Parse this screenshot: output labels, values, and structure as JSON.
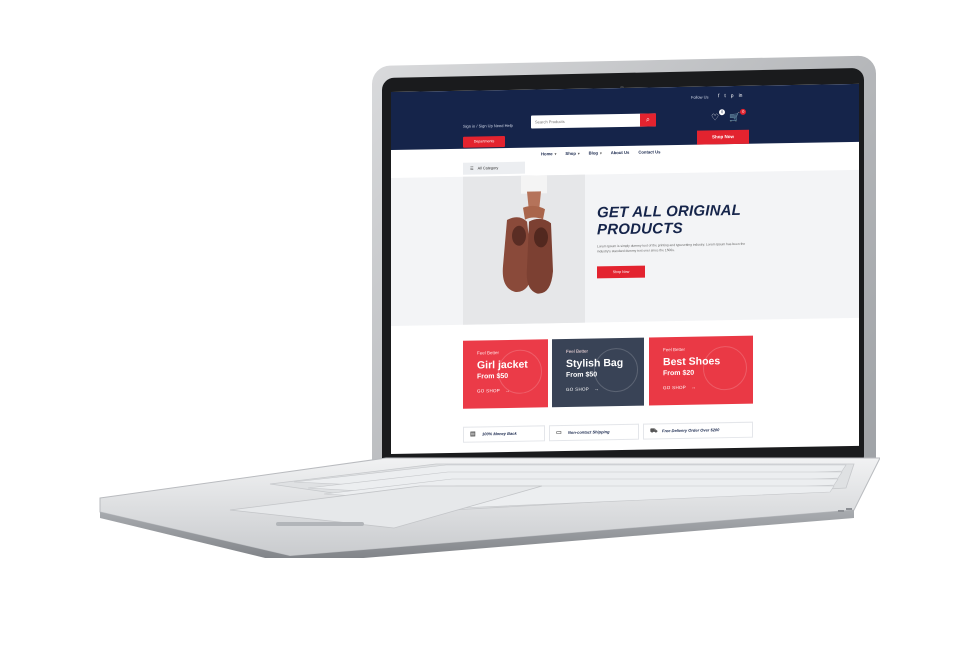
{
  "topbar": {
    "follow_label": "Follow Us",
    "social_icons": [
      "facebook-icon",
      "twitter-icon",
      "pinterest-icon",
      "linkedin-icon"
    ],
    "account_links": "Sign in / Sign Up   Need Help",
    "search_placeholder": "Search Products",
    "wishlist_count": "0",
    "cart_count": "0"
  },
  "departments_label": "Departments",
  "shop_now_top": "Shop Now",
  "nav": {
    "items": [
      "Home",
      "Shop",
      "Blog",
      "About Us",
      "Contact Us"
    ]
  },
  "all_category_label": "All Category",
  "hero": {
    "title": "GET ALL ORIGINAL PRODUCTS",
    "text": "Lorem Ipsum is simply dummy text of the printing and typesetting industry. Lorem Ipsum has been the industry's standard dummy text ever since the 1500s.",
    "button": "Shop Now"
  },
  "promos": [
    {
      "kicker": "Feel Better",
      "name": "Girl jacket",
      "price": "From $50",
      "cta": "GO SHOP"
    },
    {
      "kicker": "Feel Better",
      "name": "Stylish Bag",
      "price": "From $50",
      "cta": "GO SHOP"
    },
    {
      "kicker": "Feel Better",
      "name": "Best Shoes",
      "price": "From $20",
      "cta": "GO SHOP"
    }
  ],
  "features": [
    {
      "label": "100% Money Back"
    },
    {
      "label": "Non-contact Shipping"
    },
    {
      "label": "Free Delivery Order Over $200"
    }
  ],
  "colors": {
    "navy": "#15244a",
    "red": "#e3232f",
    "slate": "#394356"
  }
}
